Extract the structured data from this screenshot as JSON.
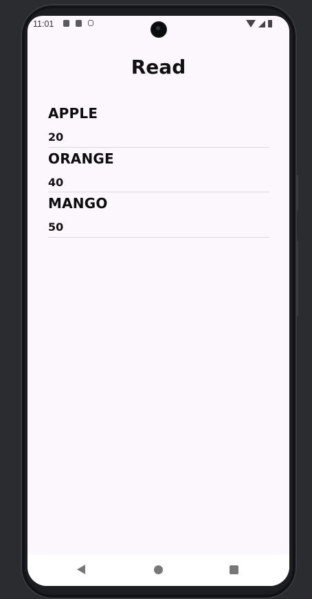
{
  "status_bar": {
    "time": "11:01",
    "left_icons": [
      "app-notification-icon",
      "sd-card-icon",
      "html5-icon"
    ],
    "right_icons": [
      "wifi-icon",
      "signal-icon",
      "battery-icon"
    ]
  },
  "page": {
    "title": "Read"
  },
  "items": [
    {
      "name": "APPLE",
      "quantity": "20"
    },
    {
      "name": "ORANGE",
      "quantity": "40"
    },
    {
      "name": "MANGO",
      "quantity": "50"
    }
  ],
  "nav_bar": {
    "icons": [
      "back-icon",
      "home-icon",
      "recents-icon"
    ]
  },
  "colors": {
    "screen_background": "#fcf6fd",
    "device_frame": "#1c1d20",
    "text": "#111111",
    "divider": "#dcd7dc"
  }
}
